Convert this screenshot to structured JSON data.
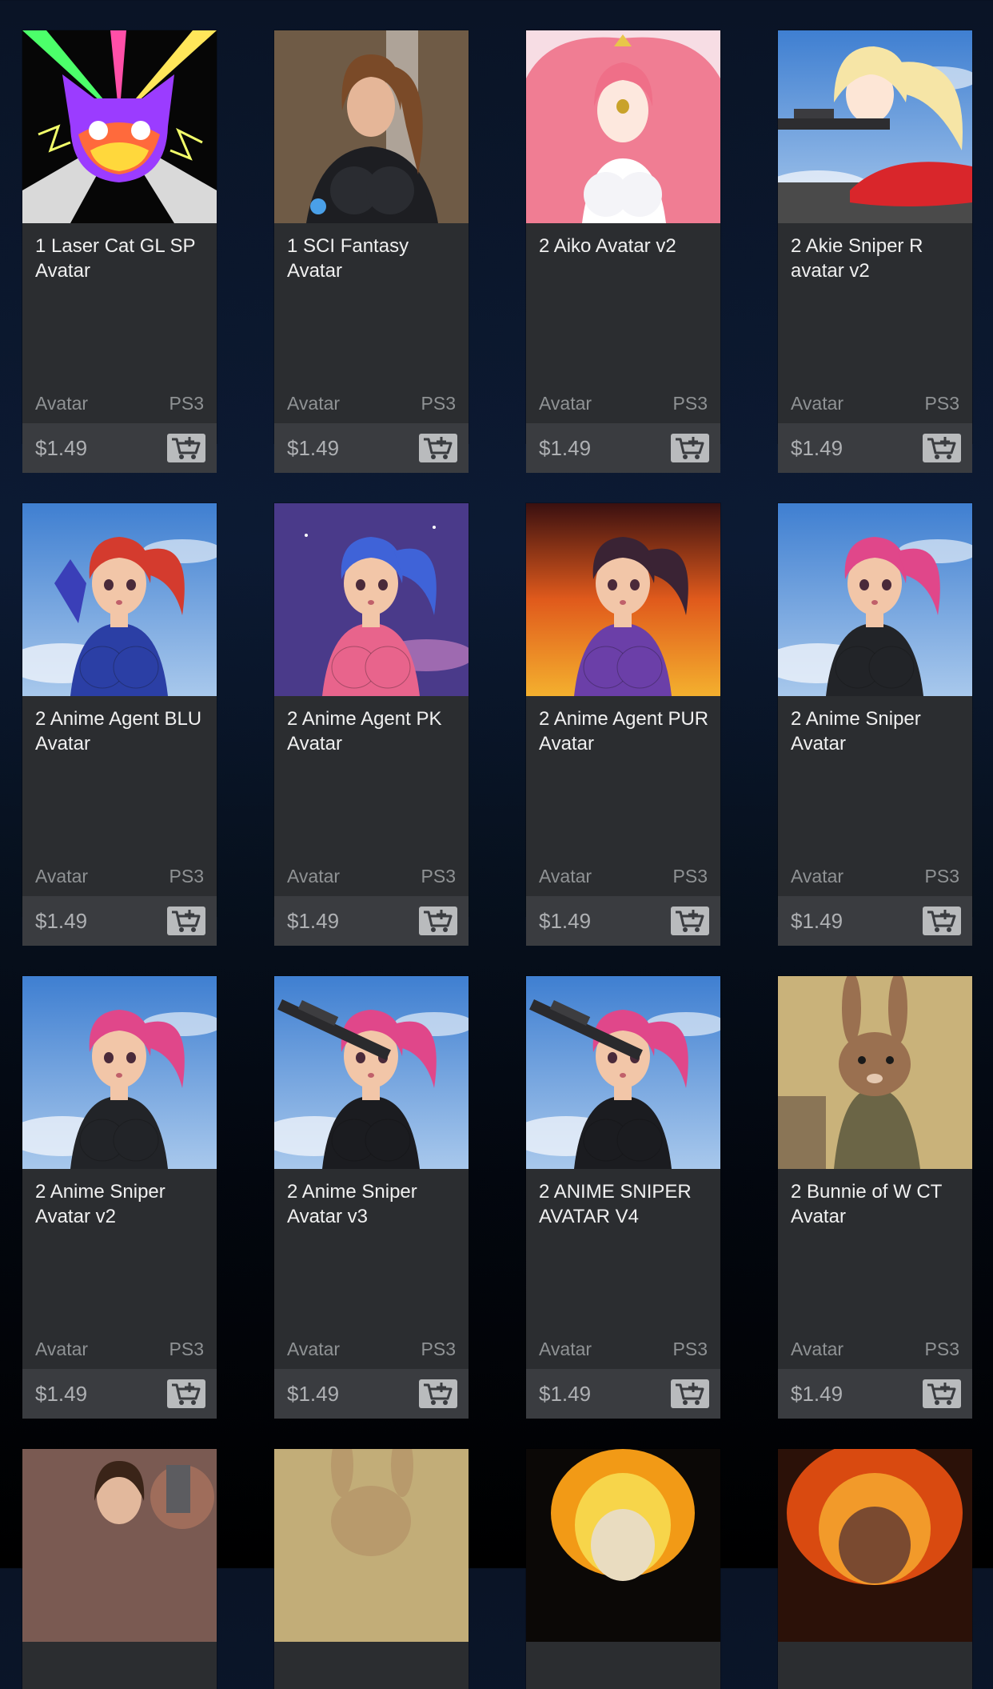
{
  "store": {
    "items": [
      {
        "title": "1 Laser Cat GL SP Avatar",
        "category": "Avatar",
        "platform": "PS3",
        "price": "$1.49",
        "thumb": "laser-cat"
      },
      {
        "title": "1 SCI Fantasy Avatar",
        "category": "Avatar",
        "platform": "PS3",
        "price": "$1.49",
        "thumb": "sci-fantasy"
      },
      {
        "title": "2 Aiko Avatar v2",
        "category": "Avatar",
        "platform": "PS3",
        "price": "$1.49",
        "thumb": "aiko"
      },
      {
        "title": "2 Akie Sniper R avatar v2",
        "category": "Avatar",
        "platform": "PS3",
        "price": "$1.49",
        "thumb": "akie"
      },
      {
        "title": "2 Anime Agent BLU Avatar",
        "category": "Avatar",
        "platform": "PS3",
        "price": "$1.49",
        "thumb": "agent-blu"
      },
      {
        "title": "2 Anime Agent PK Avatar",
        "category": "Avatar",
        "platform": "PS3",
        "price": "$1.49",
        "thumb": "agent-pk"
      },
      {
        "title": "2 Anime Agent PUR Avatar",
        "category": "Avatar",
        "platform": "PS3",
        "price": "$1.49",
        "thumb": "agent-pur"
      },
      {
        "title": "2 Anime Sniper Avatar",
        "category": "Avatar",
        "platform": "PS3",
        "price": "$1.49",
        "thumb": "sniper"
      },
      {
        "title": "2 Anime Sniper Avatar v2",
        "category": "Avatar",
        "platform": "PS3",
        "price": "$1.49",
        "thumb": "sniper-v2"
      },
      {
        "title": "2 Anime Sniper Avatar v3",
        "category": "Avatar",
        "platform": "PS3",
        "price": "$1.49",
        "thumb": "sniper-v3"
      },
      {
        "title": "2 ANIME SNIPER AVATAR V4",
        "category": "Avatar",
        "platform": "PS3",
        "price": "$1.49",
        "thumb": "sniper-v4"
      },
      {
        "title": "2 Bunnie of W CT Avatar",
        "category": "Avatar",
        "platform": "PS3",
        "price": "$1.49",
        "thumb": "bunnie"
      },
      {
        "thumb": "gunner-woman"
      },
      {
        "thumb": "soldier-rabbit"
      },
      {
        "thumb": "flame-skull"
      },
      {
        "thumb": "fire-skull"
      }
    ]
  }
}
